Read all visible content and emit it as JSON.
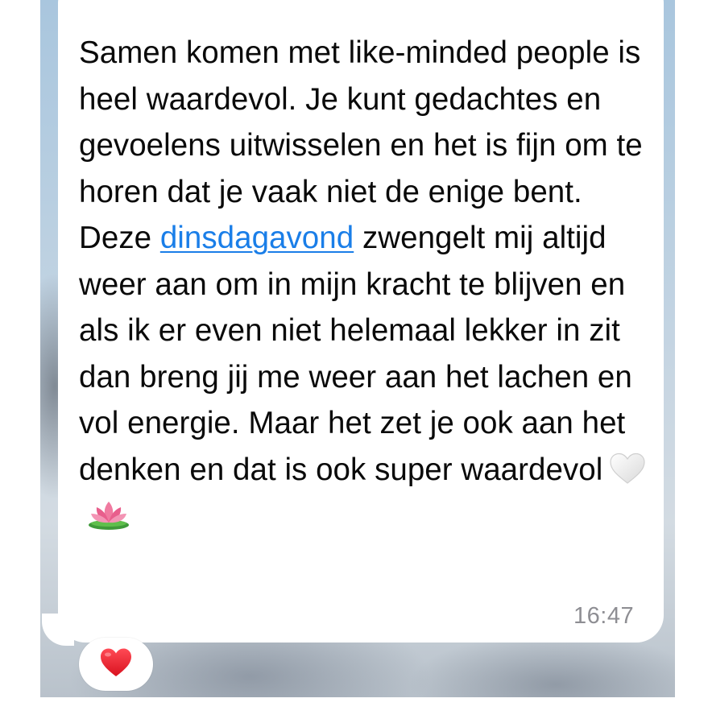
{
  "message": {
    "text_before_link": "Samen komen met like-minded people is heel waardevol. Je kunt gedachtes en gevoelens uitwisselen en het is fijn om te horen dat je vaak niet de enige bent. Deze ",
    "link_text": "dinsdagavond",
    "text_after_link": " zwengelt mij altijd weer aan om in mijn kracht te blijven en als ik er even niet helemaal lekker in zit dan breng jij me weer aan het lachen en vol energie. Maar het zet je ook aan het denken en dat is ook super waardevol",
    "emojis": [
      "white-heart-icon",
      "lotus-icon"
    ],
    "timestamp": "16:47"
  },
  "reaction": {
    "icon": "red-heart-icon",
    "color": "#e8202e"
  },
  "colors": {
    "link": "#1a7ee8",
    "bubble": "#ffffff",
    "timestamp": "#8e8e93"
  }
}
